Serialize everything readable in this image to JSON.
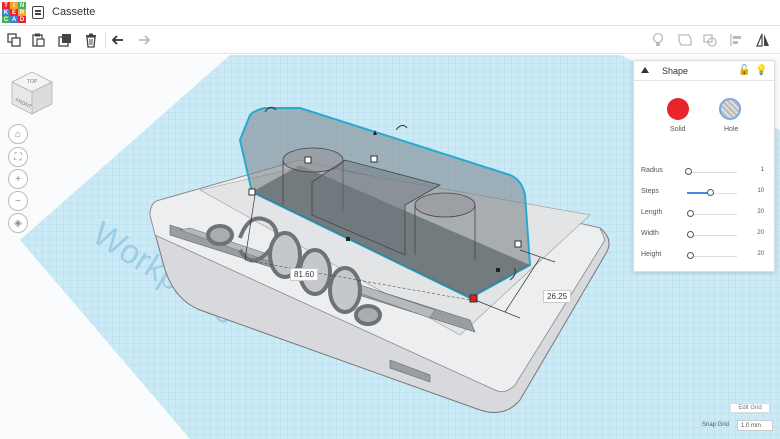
{
  "app": {
    "logo_letters": [
      "T",
      "I",
      "N",
      "K",
      "E",
      "R",
      "C",
      "A",
      "D"
    ],
    "document_title": "Cassette"
  },
  "toolbar": {
    "icons": [
      "copy-icon",
      "paste-icon",
      "duplicate-icon",
      "trash-icon",
      "undo-icon",
      "redo-icon",
      "light-icon",
      "group-icon",
      "ungroup-icon",
      "align-icon",
      "mirror-icon"
    ]
  },
  "viewcube": {
    "top": "TOP",
    "front": "FRONT"
  },
  "workplane": {
    "label": "Workplane"
  },
  "dimensions": {
    "length": "81.60",
    "width": "26.25"
  },
  "shape_panel": {
    "title": "Shape",
    "solid_label": "Solid",
    "hole_label": "Hole",
    "properties": [
      {
        "name": "Radius",
        "value": "1",
        "level": 0
      },
      {
        "name": "Steps",
        "value": "10",
        "level": 0.45
      },
      {
        "name": "Length",
        "value": "20",
        "level": 0
      },
      {
        "name": "Width",
        "value": "20",
        "level": 0
      },
      {
        "name": "Height",
        "value": "20",
        "level": 0
      }
    ]
  },
  "footer": {
    "edit_grid": "Edit Grid",
    "snap_grid_label": "Snap Grid",
    "snap_grid_value": "1.0 mm"
  }
}
